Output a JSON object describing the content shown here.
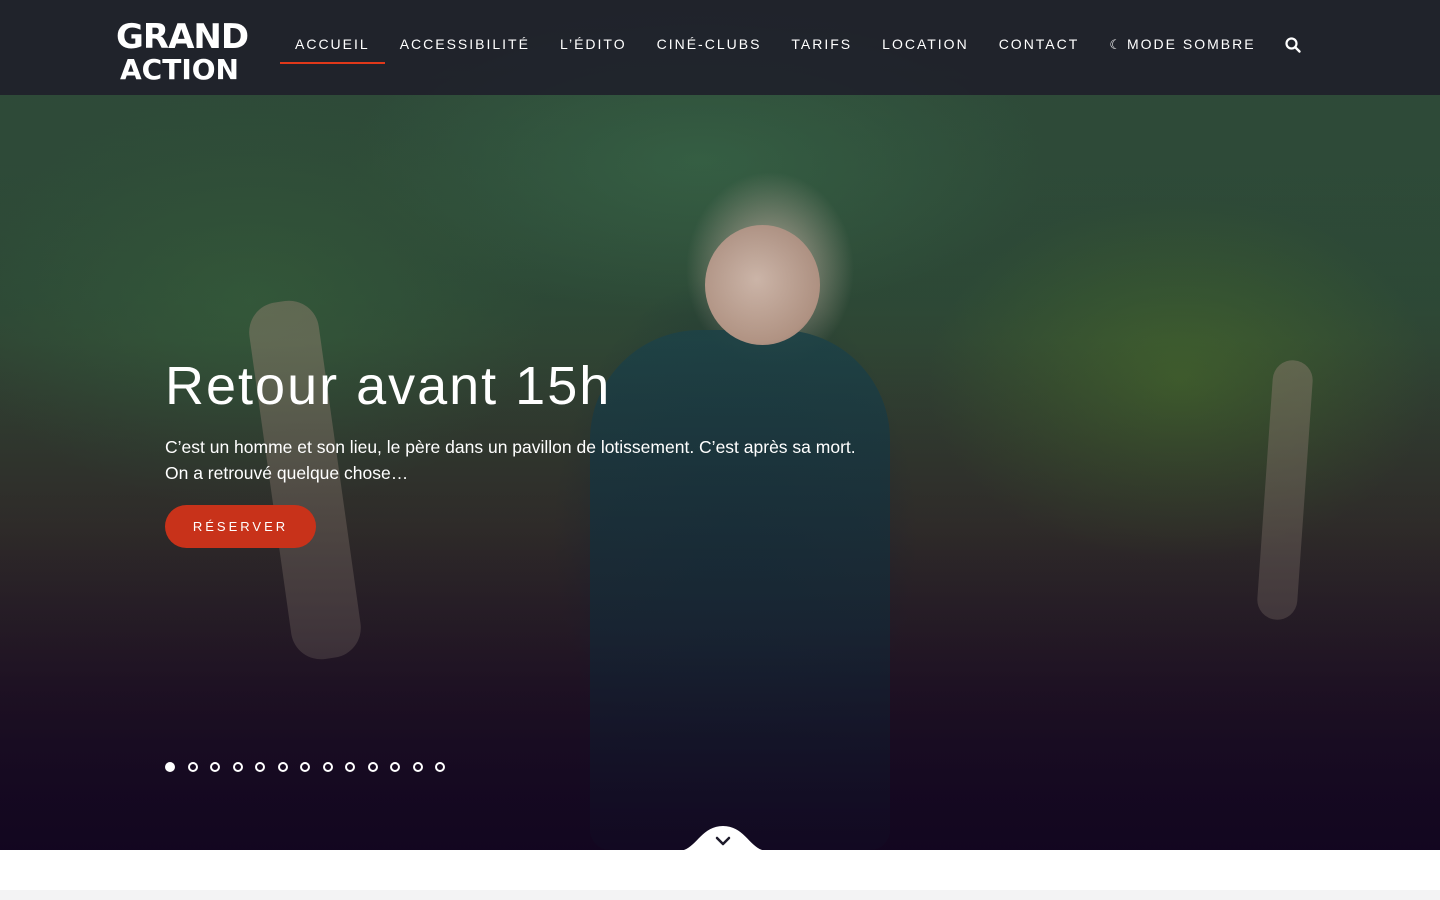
{
  "header": {
    "logo": {
      "line1": "GRAND",
      "line2": "ACTION"
    },
    "nav": [
      {
        "label": "ACCUEIL",
        "active": true
      },
      {
        "label": "ACCESSIBILITÉ"
      },
      {
        "label": "L’ÉDITO"
      },
      {
        "label": "CINÉ-CLUBS"
      },
      {
        "label": "TARIFS"
      },
      {
        "label": "LOCATION"
      },
      {
        "label": "CONTACT"
      },
      {
        "label": "MODE SOMBRE",
        "icon": "moon-icon"
      }
    ],
    "search_icon": "search-icon"
  },
  "hero": {
    "title": "Retour avant 15h",
    "description_line1": "C’est un homme et son lieu, le père dans un pavillon de lotissement. C’est après sa mort.",
    "description_line2": "On a retrouvé quelque chose…",
    "cta_label": "RÉSERVER",
    "slide_count": 13,
    "active_slide": 1
  },
  "scroll_icon": "chevron-down-icon",
  "colors": {
    "accent": "#e0381a",
    "button": "#c8321a",
    "header_bg": "#1c1828",
    "hero_bottom": "#1a0c22"
  }
}
